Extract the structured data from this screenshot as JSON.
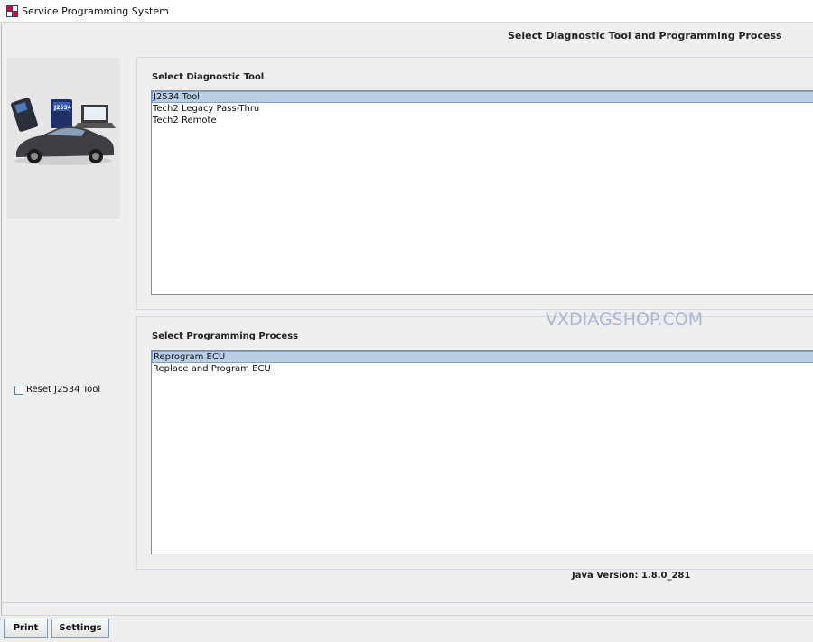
{
  "window": {
    "title": "Service Programming System",
    "icon": "sps-app-icon"
  },
  "header": {
    "title": "Select Diagnostic Tool and Programming Process"
  },
  "hero": {
    "device_label": "J2534"
  },
  "diagnostic_tool": {
    "label": "Select Diagnostic Tool",
    "items": [
      "J2534 Tool",
      "Tech2 Legacy Pass-Thru",
      "Tech2 Remote"
    ],
    "selected_index": 0
  },
  "programming_process": {
    "label": "Select Programming Process",
    "items": [
      "Reprogram ECU",
      "Replace and Program ECU"
    ],
    "selected_index": 0
  },
  "reset": {
    "label": "Reset J2534 Tool",
    "checked": false
  },
  "watermark": "VXDIAGSHOP.COM",
  "footer": {
    "java_version": "Java Version: 1.8.0_281"
  },
  "buttons": {
    "print_label": "Print",
    "settings_label": "Settings"
  },
  "colors": {
    "selection": "#b8cfe5",
    "border_accent": "#7f9db9",
    "watermark": "#a9b8cf"
  }
}
